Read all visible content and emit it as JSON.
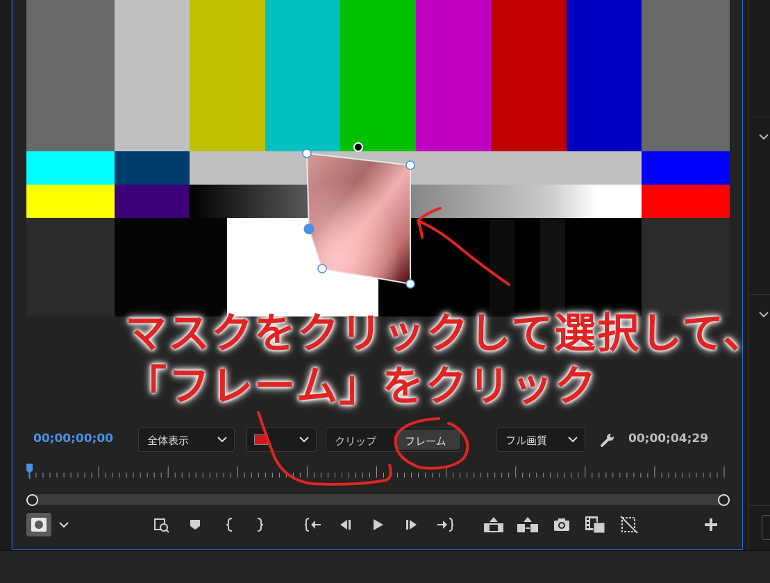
{
  "monitor": {
    "current_timecode": "00;00;00;00",
    "duration_timecode": "00;00;04;29",
    "zoom_dropdown": {
      "value": "全体表示"
    },
    "mask_track_dropdown": {
      "value": ""
    },
    "track_mode": {
      "clip_label": "クリップ",
      "frame_label": "フレーム",
      "selected": "フレーム"
    },
    "quality_dropdown": {
      "value": "フル画質"
    }
  },
  "annotation": {
    "line1": "マスクをクリックして選択して、",
    "line2": "「フレーム」をクリック"
  },
  "colors": {
    "accent_blue": "#4a90e2",
    "annotation_red": "#e02424",
    "mask_fill_light": "#f4b6b6",
    "mask_fill_dark": "#5a0a0a"
  },
  "transport_icons": [
    "add-marker-icon",
    "mark-in-icon",
    "mark-out-icon",
    "go-to-in-icon",
    "step-back-icon",
    "play-icon",
    "step-forward-icon",
    "go-to-out-icon",
    "lift-icon",
    "extract-icon",
    "export-frame-icon",
    "comparison-view-icon",
    "toggle-proxies-icon",
    "add-button-icon"
  ]
}
